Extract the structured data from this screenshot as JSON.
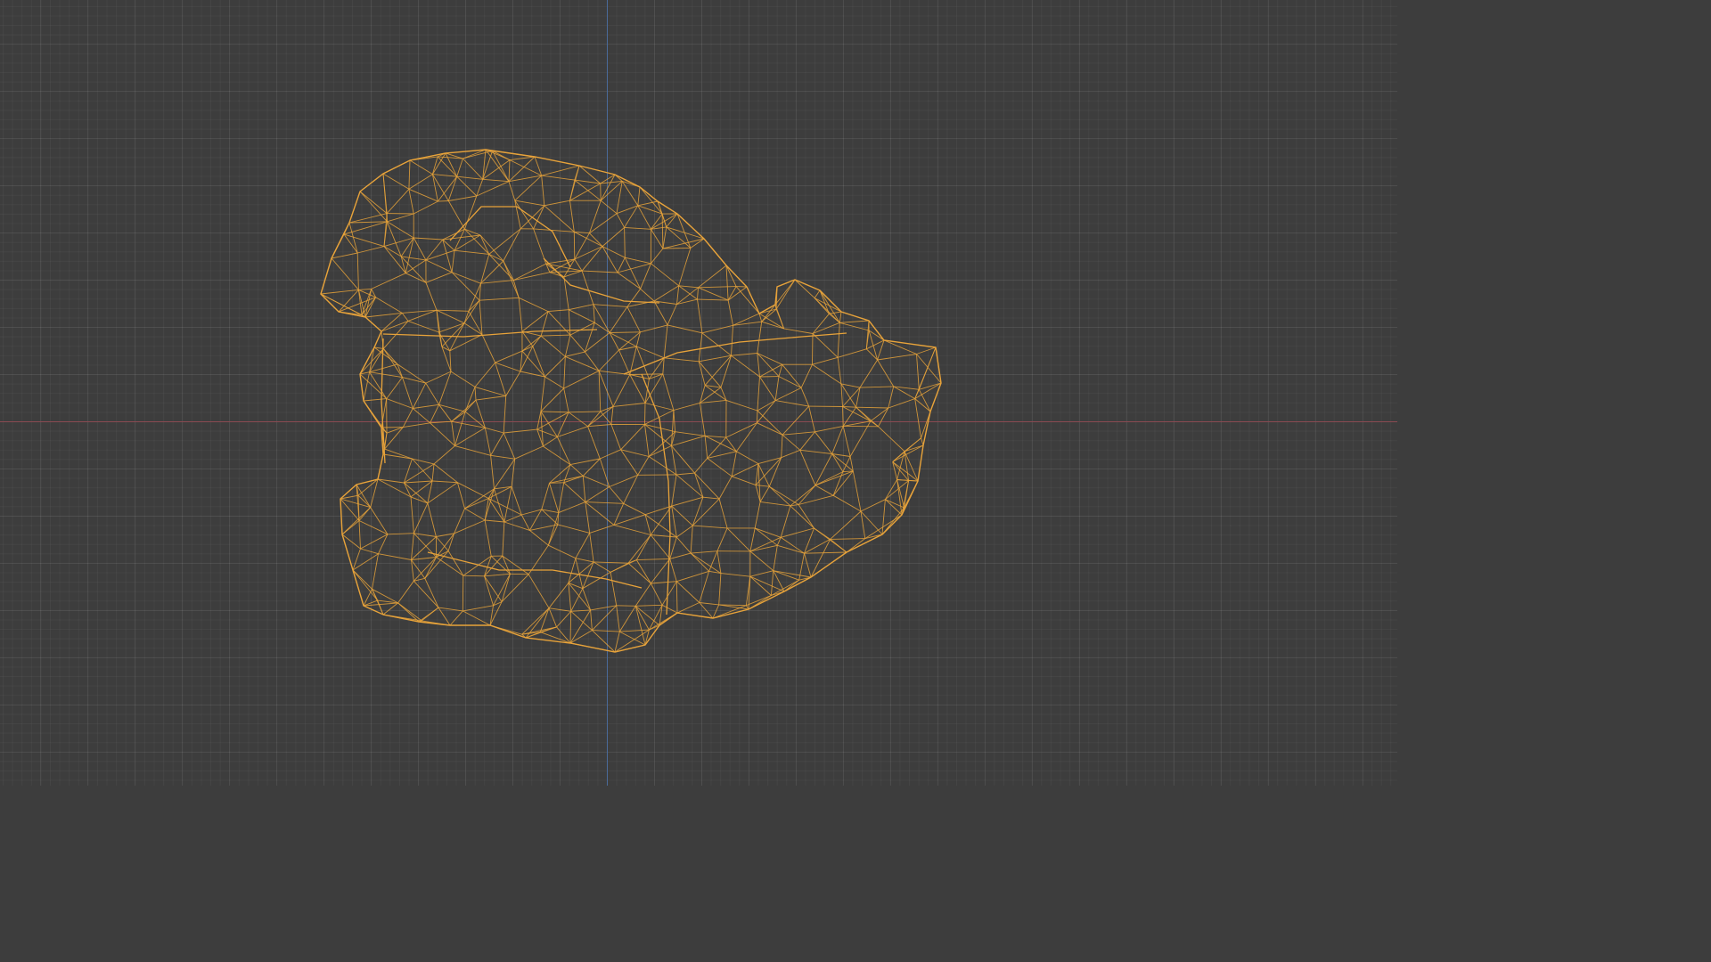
{
  "viewport": {
    "mode": "wireframe",
    "background_color": "#3d3d3d",
    "grid_color": "#4a4a4a",
    "x_axis_color": "#8a4a52",
    "z_axis_color": "#4a6a9a"
  },
  "mesh": {
    "object": "rock-wireframe",
    "edge_color": "#e8a33a"
  }
}
